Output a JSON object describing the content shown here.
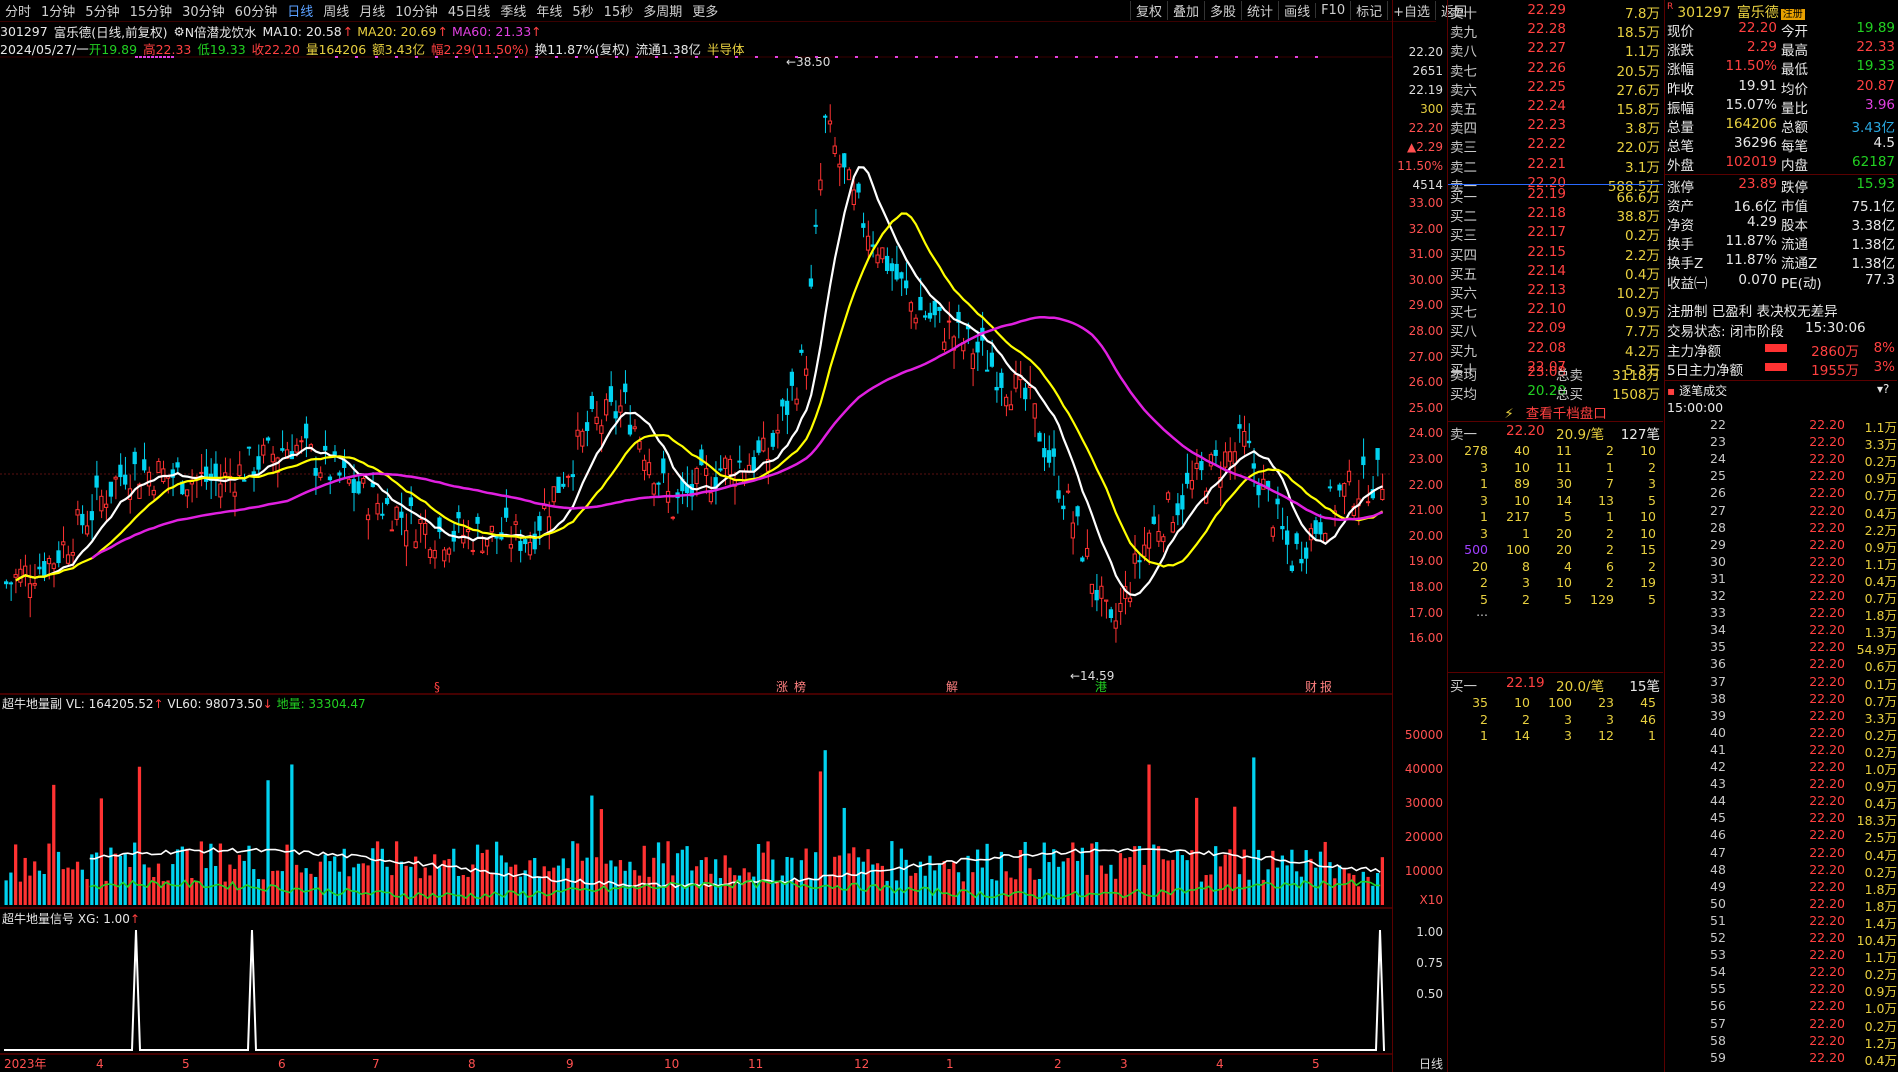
{
  "toolbar": {
    "periods": [
      "分时",
      "1分钟",
      "5分钟",
      "15分钟",
      "30分钟",
      "60分钟",
      "日线",
      "周线",
      "月线",
      "10分钟",
      "45日线",
      "季线",
      "年线",
      "5秒",
      "15秒",
      "多周期",
      "更多"
    ],
    "active": "日线",
    "right_buttons": [
      "复权",
      "叠加",
      "多股",
      "统计",
      "画线",
      "F10",
      "标记",
      "+自选",
      "返回"
    ]
  },
  "stock": {
    "code": "301297",
    "name": "富乐德",
    "mode": "(日线,前复权)",
    "indicator": "N倍潜龙饮水",
    "ma10_label": "MA10: 20.58",
    "ma20_label": "MA20: 20.69",
    "ma60_label": "MA60: 21.33",
    "date": "2024/05/27/一",
    "open": "开19.89",
    "high": "高22.33",
    "low": "低19.33",
    "close": "收22.20",
    "volume": "量164206",
    "amount": "额3.43亿",
    "change": "幅2.29(11.50%)",
    "turnover": "换11.87%(复权)",
    "float": "流通1.38亿",
    "sector": "半导体"
  },
  "main_chart": {
    "peak_label": "38.50",
    "trough_label": "14.59",
    "price_axis": [
      "33.00",
      "32.00",
      "31.00",
      "30.00",
      "29.00",
      "28.00",
      "27.00",
      "26.00",
      "25.00",
      "24.00",
      "23.00",
      "22.00",
      "21.00",
      "20.00",
      "19.00",
      "18.00",
      "17.00",
      "16.00"
    ],
    "axis_top": [
      "22.20",
      "2651",
      "22.19",
      "300",
      "22.20",
      "▲2.29",
      "11.50%",
      "4514"
    ],
    "x_labels": [
      "2023年",
      "4",
      "5",
      "6",
      "7",
      "8",
      "9",
      "10",
      "11",
      "12",
      "1",
      "2",
      "3",
      "4",
      "5"
    ],
    "event_tags": [
      "§",
      "涨",
      "榜",
      "解",
      "港",
      "财",
      "报"
    ]
  },
  "vol_panel": {
    "title": "超牛地量副",
    "vl": "VL: 164205.52",
    "vl60": "VL60: 98073.50",
    "diliang": "地量: 33304.47",
    "axis": [
      "50000",
      "40000",
      "30000",
      "20000",
      "10000"
    ],
    "unit": "X10"
  },
  "sig_panel": {
    "title": "超牛地量信号",
    "xg": "XG: 1.00",
    "axis": [
      "1.00",
      "0.75",
      "0.50"
    ],
    "period_label": "日线"
  },
  "chart_data": [
    {
      "type": "candlestick",
      "title": "301297 富乐德(日线,前复权)",
      "ylim": [
        14.59,
        38.5
      ],
      "x_range": [
        "2023年",
        "2024/05/27"
      ],
      "series": [
        {
          "name": "MA10",
          "color": "#ffffff"
        },
        {
          "name": "MA20",
          "color": "#ffff00"
        },
        {
          "name": "MA60",
          "color": "#e020e0"
        }
      ],
      "highlights": {
        "max": 38.5,
        "min": 14.59,
        "last_close": 22.2
      }
    },
    {
      "type": "bar",
      "title": "超牛地量副",
      "ylim": [
        0,
        60000
      ],
      "series": [
        {
          "name": "VL",
          "last": 164205.52
        },
        {
          "name": "VL60",
          "last": 98073.5
        },
        {
          "name": "地量",
          "last": 33304.47
        }
      ]
    },
    {
      "type": "line",
      "title": "超牛地量信号",
      "ylim": [
        0,
        1
      ],
      "spikes": 3,
      "series": [
        {
          "name": "XG",
          "last": 1.0
        }
      ]
    }
  ],
  "order_book": {
    "sells": [
      {
        "label": "卖十",
        "price": "22.29",
        "vol": "7.8万"
      },
      {
        "label": "卖九",
        "price": "22.28",
        "vol": "18.5万"
      },
      {
        "label": "卖八",
        "price": "22.27",
        "vol": "1.1万"
      },
      {
        "label": "卖七",
        "price": "22.26",
        "vol": "20.5万"
      },
      {
        "label": "卖六",
        "price": "22.25",
        "vol": "27.6万"
      },
      {
        "label": "卖五",
        "price": "22.24",
        "vol": "15.8万"
      },
      {
        "label": "卖四",
        "price": "22.23",
        "vol": "3.8万"
      },
      {
        "label": "卖三",
        "price": "22.22",
        "vol": "22.0万"
      },
      {
        "label": "卖二",
        "price": "22.21",
        "vol": "3.1万"
      },
      {
        "label": "卖一",
        "price": "22.20",
        "vol": "588.5万"
      }
    ],
    "buys": [
      {
        "label": "买一",
        "price": "22.19",
        "vol": "66.6万"
      },
      {
        "label": "买二",
        "price": "22.18",
        "vol": "38.8万"
      },
      {
        "label": "买三",
        "price": "22.17",
        "vol": "0.2万"
      },
      {
        "label": "买四",
        "price": "22.15",
        "vol": "2.2万"
      },
      {
        "label": "买五",
        "price": "22.14",
        "vol": "0.4万"
      },
      {
        "label": "买六",
        "price": "22.13",
        "vol": "10.2万"
      },
      {
        "label": "买七",
        "price": "22.10",
        "vol": "0.9万"
      },
      {
        "label": "买八",
        "price": "22.09",
        "vol": "7.7万"
      },
      {
        "label": "买九",
        "price": "22.08",
        "vol": "4.2万"
      },
      {
        "label": "买十",
        "price": "22.07",
        "vol": "5.3万"
      }
    ],
    "sell_avg": {
      "label": "卖均",
      "price": "23.08",
      "tot_label": "总卖",
      "tot": "3118万"
    },
    "buy_avg": {
      "label": "买均",
      "price": "20.20",
      "tot_label": "总买",
      "tot": "1508万"
    },
    "depth_link": "查看千档盘口",
    "sell1_queue": {
      "label": "卖一",
      "price": "22.20",
      "per": "20.9/笔",
      "count": "127笔",
      "rows": [
        [
          "278",
          "40",
          "11",
          "2",
          "10"
        ],
        [
          "3",
          "10",
          "11",
          "1",
          "2"
        ],
        [
          "1",
          "89",
          "30",
          "7",
          "3"
        ],
        [
          "3",
          "10",
          "14",
          "13",
          "5"
        ],
        [
          "1",
          "217",
          "5",
          "1",
          "10"
        ],
        [
          "3",
          "1",
          "20",
          "2",
          "10"
        ],
        [
          "500",
          "100",
          "20",
          "2",
          "15"
        ],
        [
          "20",
          "8",
          "4",
          "6",
          "2"
        ],
        [
          "2",
          "3",
          "10",
          "2",
          "19"
        ],
        [
          "5",
          "2",
          "5",
          "129",
          "5"
        ]
      ],
      "more": "..."
    },
    "buy1_queue": {
      "label": "买一",
      "price": "22.19",
      "per": "20.0/笔",
      "count": "15笔",
      "rows": [
        [
          "35",
          "10",
          "100",
          "23",
          "45"
        ],
        [
          "2",
          "2",
          "3",
          "3",
          "46"
        ],
        [
          "1",
          "14",
          "3",
          "12",
          "1"
        ]
      ]
    }
  },
  "quote": {
    "code": "301297",
    "name": "富乐德",
    "badge": "注册",
    "rows": [
      {
        "l1": "现价",
        "v1": "22.20",
        "l2": "今开",
        "v2": "19.89",
        "c1": "red",
        "c2": "green"
      },
      {
        "l1": "涨跌",
        "v1": "2.29",
        "l2": "最高",
        "v2": "22.33",
        "c1": "red",
        "c2": "red"
      },
      {
        "l1": "涨幅",
        "v1": "11.50%",
        "l2": "最低",
        "v2": "19.33",
        "c1": "red",
        "c2": "green"
      },
      {
        "l1": "昨收",
        "v1": "19.91",
        "l2": "均价",
        "v2": "20.87",
        "c1": "white",
        "c2": "red"
      },
      {
        "l1": "振幅",
        "v1": "15.07%",
        "l2": "量比",
        "v2": "3.96",
        "c1": "white",
        "c2": "mag"
      },
      {
        "l1": "总量",
        "v1": "164206",
        "l2": "总额",
        "v2": "3.43亿",
        "c1": "yellow",
        "c2": "cyan"
      },
      {
        "l1": "总笔",
        "v1": "36296",
        "l2": "每笔",
        "v2": "4.5",
        "c1": "white",
        "c2": "white"
      },
      {
        "l1": "外盘",
        "v1": "102019",
        "l2": "内盘",
        "v2": "62187",
        "c1": "red",
        "c2": "green"
      },
      {
        "l1": "涨停",
        "v1": "23.89",
        "l2": "跌停",
        "v2": "15.93",
        "c1": "red",
        "c2": "green"
      },
      {
        "l1": "资产",
        "v1": "16.6亿",
        "l2": "市值",
        "v2": "75.1亿",
        "c1": "white",
        "c2": "white"
      },
      {
        "l1": "净资",
        "v1": "4.29",
        "l2": "股本",
        "v2": "3.38亿",
        "c1": "white",
        "c2": "white"
      },
      {
        "l1": "换手",
        "v1": "11.87%",
        "l2": "流通",
        "v2": "1.38亿",
        "c1": "white",
        "c2": "white"
      },
      {
        "l1": "换手Z",
        "v1": "11.87%",
        "l2": "流通Z",
        "v2": "1.38亿",
        "c1": "white",
        "c2": "white"
      },
      {
        "l1": "收益㈠",
        "v1": "0.070",
        "l2": "PE(动)",
        "v2": "77.3",
        "c1": "white",
        "c2": "white"
      }
    ],
    "reg_line": "注册制 已盈利 表决权无差异",
    "status_label": "交易状态: 闭市阶段",
    "status_time": "15:30:06",
    "main_flow": {
      "label": "主力净额",
      "value": "2860万",
      "pct": "8%"
    },
    "main_flow5": {
      "label": "5日主力净额",
      "value": "1955万",
      "pct": "3%"
    },
    "ticks_title": "逐笔成交",
    "ticks_head": "15:00:00",
    "ticks": [
      {
        "t": "22",
        "p": "22.20",
        "v": "1.1万"
      },
      {
        "t": "23",
        "p": "22.20",
        "v": "3.3万"
      },
      {
        "t": "24",
        "p": "22.20",
        "v": "0.2万"
      },
      {
        "t": "25",
        "p": "22.20",
        "v": "0.9万"
      },
      {
        "t": "26",
        "p": "22.20",
        "v": "0.7万"
      },
      {
        "t": "27",
        "p": "22.20",
        "v": "0.4万"
      },
      {
        "t": "28",
        "p": "22.20",
        "v": "2.2万"
      },
      {
        "t": "29",
        "p": "22.20",
        "v": "0.9万"
      },
      {
        "t": "30",
        "p": "22.20",
        "v": "1.1万"
      },
      {
        "t": "31",
        "p": "22.20",
        "v": "0.4万"
      },
      {
        "t": "32",
        "p": "22.20",
        "v": "0.7万"
      },
      {
        "t": "33",
        "p": "22.20",
        "v": "1.8万"
      },
      {
        "t": "34",
        "p": "22.20",
        "v": "1.3万"
      },
      {
        "t": "35",
        "p": "22.20",
        "v": "54.9万"
      },
      {
        "t": "36",
        "p": "22.20",
        "v": "0.6万"
      },
      {
        "t": "37",
        "p": "22.20",
        "v": "0.1万"
      },
      {
        "t": "38",
        "p": "22.20",
        "v": "0.7万"
      },
      {
        "t": "39",
        "p": "22.20",
        "v": "3.3万"
      },
      {
        "t": "40",
        "p": "22.20",
        "v": "0.2万"
      },
      {
        "t": "41",
        "p": "22.20",
        "v": "0.2万"
      },
      {
        "t": "42",
        "p": "22.20",
        "v": "1.0万"
      },
      {
        "t": "43",
        "p": "22.20",
        "v": "0.9万"
      },
      {
        "t": "44",
        "p": "22.20",
        "v": "0.4万"
      },
      {
        "t": "45",
        "p": "22.20",
        "v": "18.3万"
      },
      {
        "t": "46",
        "p": "22.20",
        "v": "2.5万"
      },
      {
        "t": "47",
        "p": "22.20",
        "v": "0.4万"
      },
      {
        "t": "48",
        "p": "22.20",
        "v": "0.2万"
      },
      {
        "t": "49",
        "p": "22.20",
        "v": "1.8万"
      },
      {
        "t": "50",
        "p": "22.20",
        "v": "1.8万"
      },
      {
        "t": "51",
        "p": "22.20",
        "v": "1.4万"
      },
      {
        "t": "52",
        "p": "22.20",
        "v": "10.4万"
      },
      {
        "t": "53",
        "p": "22.20",
        "v": "1.1万"
      },
      {
        "t": "54",
        "p": "22.20",
        "v": "0.2万"
      },
      {
        "t": "55",
        "p": "22.20",
        "v": "0.9万"
      },
      {
        "t": "56",
        "p": "22.20",
        "v": "1.0万"
      },
      {
        "t": "57",
        "p": "22.20",
        "v": "0.2万"
      },
      {
        "t": "58",
        "p": "22.20",
        "v": "1.2万"
      },
      {
        "t": "59",
        "p": "22.20",
        "v": "0.4万"
      }
    ]
  }
}
